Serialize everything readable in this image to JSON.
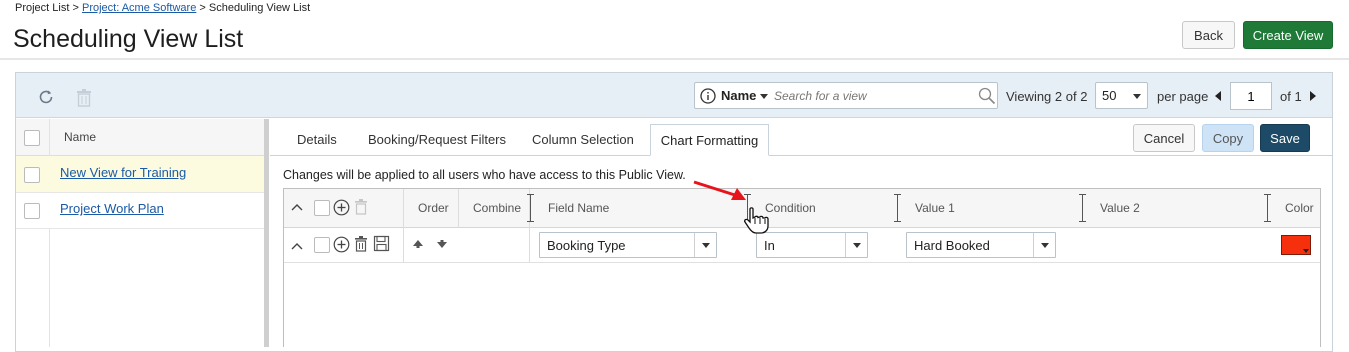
{
  "breadcrumb": {
    "project_list": "Project List",
    "sep1": ">",
    "project": "Project: Acme Software",
    "sep2": ">",
    "current": "Scheduling View List"
  },
  "page_title": "Scheduling View List",
  "header_buttons": {
    "back": "Back",
    "create_view": "Create View"
  },
  "toolbar": {
    "search_field": "Name",
    "search_placeholder": "Search for a view",
    "viewing_prefix": "Viewing",
    "viewing_count": "2 of 2",
    "per_page_value": "50",
    "per_page_label": "per page",
    "page_value": "1",
    "of_pages": "of 1"
  },
  "view_list": {
    "column_name": "Name",
    "rows": [
      "New View for Training",
      "Project Work Plan"
    ]
  },
  "tabs": [
    "Details",
    "Booking/Request Filters",
    "Column Selection",
    "Chart Formatting"
  ],
  "active_tab": "Chart Formatting",
  "actions": {
    "cancel": "Cancel",
    "copy": "Copy",
    "save": "Save"
  },
  "notice": "Changes will be applied to all users who have access to this Public View.",
  "grid": {
    "columns": [
      "Order",
      "Combine",
      "Field Name",
      "Condition",
      "Value 1",
      "Value 2",
      "Color"
    ],
    "rows": [
      {
        "field_name": "Booking Type",
        "condition": "In",
        "value1": "Hard Booked",
        "value2": "",
        "color": "#f62f0c"
      }
    ]
  },
  "colors": {
    "create_view": "#1f7a38",
    "save": "#1d4a66",
    "copy": "#cfe3f7",
    "link": "#1a5aa6",
    "selected_row": "#fcfbe0",
    "annotation_arrow": "#e8141b"
  }
}
